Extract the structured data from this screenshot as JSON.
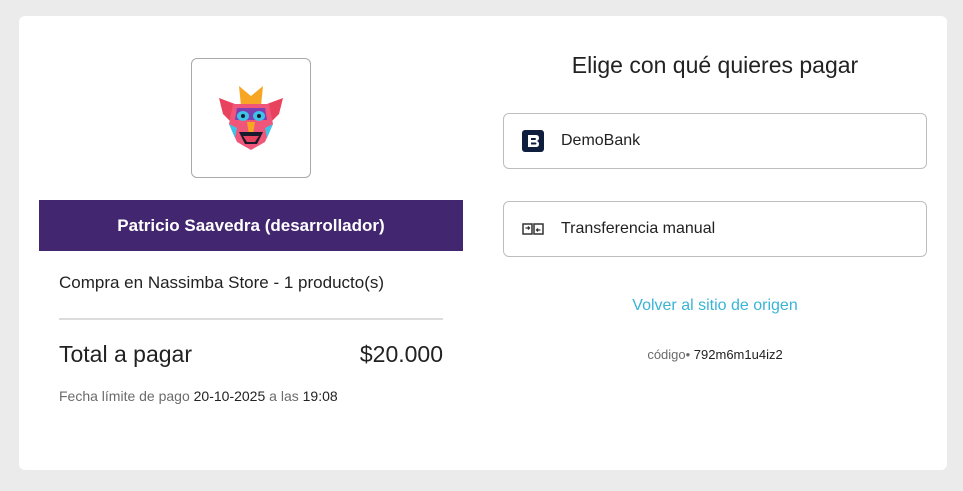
{
  "colors": {
    "merchant_bar": "#42266f",
    "link": "#39b4d6",
    "demobank_icon": "#0f1e3d"
  },
  "merchant": {
    "logo_icon": "mask-logo-icon",
    "name": "Patricio Saavedra (desarrollador)"
  },
  "order": {
    "summary": "Compra en Nassimba Store - 1 producto(s)",
    "total_label": "Total a pagar",
    "total_amount": "$20.000",
    "due_prefix": "Fecha límite de pago",
    "due_date": "20-10-2025",
    "due_middle": "a las",
    "due_time": "19:08"
  },
  "payment": {
    "title": "Elige con qué quieres pagar",
    "options": [
      {
        "label": "DemoBank",
        "icon": "demobank-icon"
      },
      {
        "label": "Transferencia manual",
        "icon": "transfer-icon"
      }
    ],
    "back_link": "Volver al sitio de origen",
    "code_label": "código",
    "code_value": "792m6m1u4iz2"
  }
}
